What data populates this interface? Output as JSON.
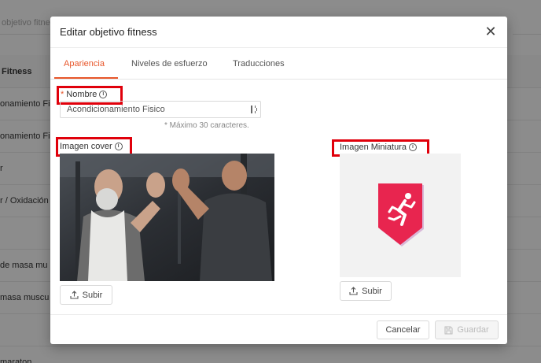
{
  "background": {
    "search_placeholder": "objetivo fitne",
    "table_header": "Fitness",
    "rows": [
      "onamiento Fi",
      "onamiento Fi",
      "r",
      "r / Oxidación",
      "",
      "de masa mu",
      "masa muscu",
      "",
      "maraton"
    ]
  },
  "modal": {
    "title": "Editar objetivo fitness",
    "close_glyph": "✕",
    "tabs": [
      {
        "label": "Apariencia",
        "active": true
      },
      {
        "label": "Niveles de esfuerzo",
        "active": false
      },
      {
        "label": "Traducciones",
        "active": false
      }
    ],
    "name_field": {
      "required_mark": "*",
      "label": "Nombre",
      "value": "Acondicionamiento Fisico",
      "hint": "* Máximo 30 caracteres."
    },
    "cover": {
      "label": "Imagen cover",
      "upload_label": "Subir"
    },
    "thumbnail": {
      "label": "Imagen Miniatura",
      "upload_label": "Subir"
    },
    "footer": {
      "cancel_label": "Cancelar",
      "save_label": "Guardar"
    }
  },
  "colors": {
    "accent": "#e8572b",
    "highlight_box": "#e0000b",
    "badge": "#e8254f"
  }
}
